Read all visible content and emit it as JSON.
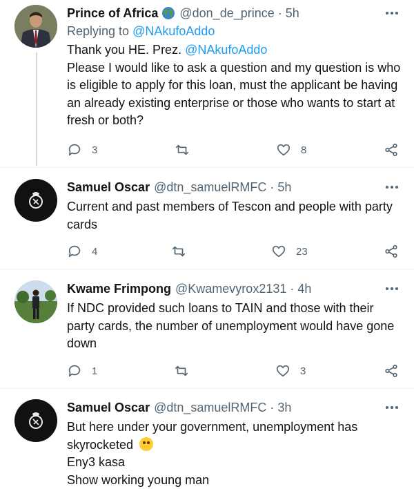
{
  "tweets": [
    {
      "name": "Prince of Africa",
      "badge": "globe-emoji",
      "handle": "@don_de_prince",
      "dot": "·",
      "time": "5h",
      "replying_prefix": "Replying to",
      "replying_to": "@NAkufoAddo",
      "text_line1_prefix": "Thank you HE. Prez.",
      "text_line1_mention": "@NAkufoAddo",
      "text_body": "Please I would like to ask a question  and my question is who is eligible to apply for this loan, must the applicant be having an already existing enterprise or those who wants to start at fresh or both?",
      "replies": "3",
      "retweets": "",
      "likes": "8"
    },
    {
      "name": "Samuel Oscar",
      "handle": "@dtn_samuelRMFC",
      "dot": "·",
      "time": "5h",
      "text": "Current and past members of Tescon and people with party cards",
      "replies": "4",
      "retweets": "",
      "likes": "23"
    },
    {
      "name": "Kwame Frimpong",
      "handle": "@Kwamevyrox2131",
      "dot": "·",
      "time": "4h",
      "text": "If NDC provided such loans to TAIN and those with their party cards, the number of unemployment would have gone down",
      "replies": "1",
      "retweets": "",
      "likes": "3"
    },
    {
      "name": "Samuel Oscar",
      "handle": "@dtn_samuelRMFC",
      "dot": "·",
      "time": "3h",
      "text_line1": "But here under your government, unemployment has skyrocketed",
      "emoji": "face-with-tears-of-joy",
      "text_line2": "Eny3 kasa",
      "text_line3": "Show working young man"
    }
  ],
  "colors": {
    "link": "#1d9bf0",
    "muted": "#536471",
    "text": "#0f1419"
  }
}
